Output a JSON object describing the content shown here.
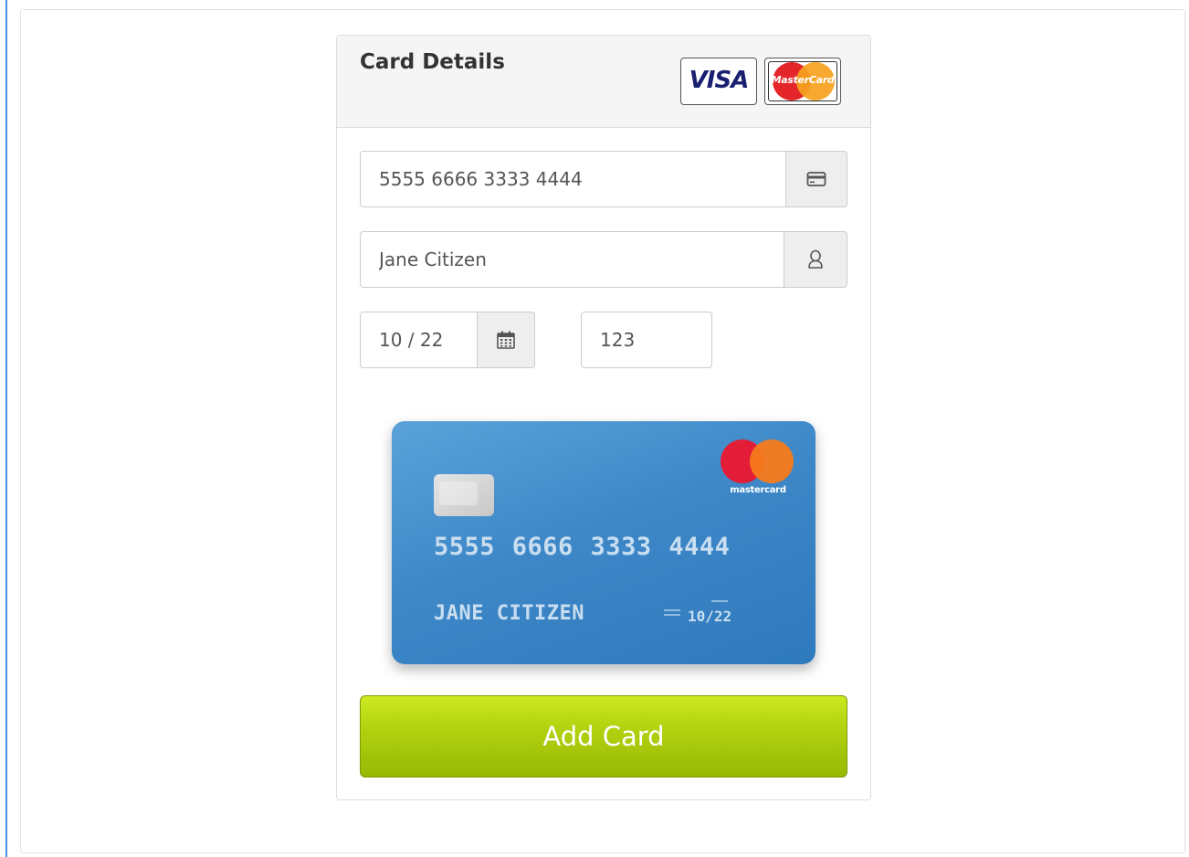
{
  "panel": {
    "title": "Card Details",
    "brand_logos": [
      {
        "name": "visa",
        "text": "VISA"
      },
      {
        "name": "mastercard",
        "text": "MasterCard"
      }
    ]
  },
  "form": {
    "card_number": {
      "value": "5555 6666 3333 4444",
      "icon": "credit-card-icon"
    },
    "cardholder_name": {
      "value": "Jane Citizen",
      "icon": "user-icon"
    },
    "expiry": {
      "value": "10 / 22",
      "icon": "calendar-icon"
    },
    "cvc": {
      "value": "123"
    }
  },
  "card_preview": {
    "number": "5555 6666 3333 4444",
    "name": "JANE CITIZEN",
    "expiry": "10/22",
    "brand": "mastercard",
    "color": "#3e88c8"
  },
  "actions": {
    "submit_label": "Add Card"
  },
  "colors": {
    "button": "#b2d20f",
    "card_blue": "#3e88c8",
    "accent": "#4a8fd8"
  }
}
